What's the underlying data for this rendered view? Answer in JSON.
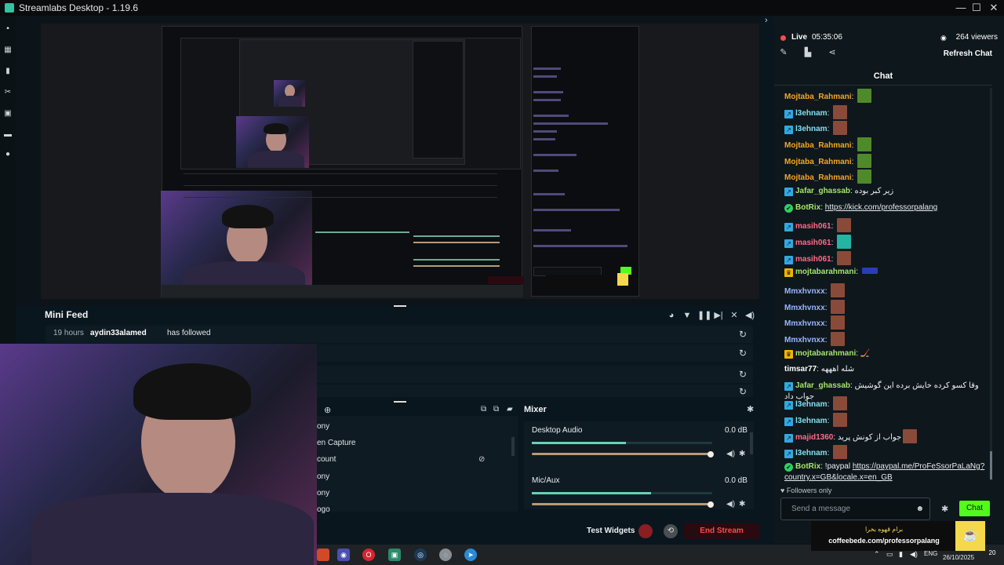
{
  "app": {
    "title": "Streamlabs Desktop - 1.19.6",
    "window_controls": [
      "—",
      "☐",
      "✕"
    ]
  },
  "nav_icons": [
    "studio-icon",
    "themes-icon",
    "layout-icon",
    "tools-icon",
    "store-icon",
    "cast-icon",
    "highlighter-icon"
  ],
  "mini_feed": {
    "title": "Mini Feed",
    "controls": [
      "pie-chart-icon",
      "filter-icon",
      "pause-icon",
      "skip-icon",
      "mute-alerts-icon",
      "volume-icon"
    ],
    "rows": [
      {
        "time": "19 hours",
        "user": "aydin33alamed",
        "action": "has followed",
        "replay": "↻"
      },
      {
        "time": "",
        "user": "",
        "action": "",
        "replay": "↻"
      },
      {
        "time": "",
        "user": "",
        "action": "",
        "replay": "↻"
      },
      {
        "time": "",
        "user": "",
        "action": "",
        "replay": "↻"
      }
    ]
  },
  "sources": {
    "items": [
      "ony",
      "en Capture",
      "count",
      "ony",
      "ony",
      "ogo"
    ]
  },
  "mixer": {
    "title": "Mixer",
    "channels": [
      {
        "name": "Desktop Audio",
        "db": "0.0 dB",
        "meter_level": 0.52,
        "slider_level": 1.0
      },
      {
        "name": "Mic/Aux",
        "db": "0.0 dB",
        "meter_level": 0.66,
        "slider_level": 1.0
      }
    ]
  },
  "footer": {
    "test_widgets": "Test Widgets",
    "end_stream": "End Stream"
  },
  "live": {
    "label": "Live",
    "time": "05:35:06",
    "viewers": "264 viewers",
    "refresh_chat": "Refresh Chat"
  },
  "chat": {
    "title": "Chat",
    "messages": [
      {
        "user": "Mojtaba_Rahmani",
        "color": "#f5a623",
        "badge": "",
        "text": "",
        "emote": "green"
      },
      {
        "user": "l3ehnam",
        "color": "#7ee0f0",
        "badge": "sub",
        "text": "",
        "emote": "face"
      },
      {
        "user": "l3ehnam",
        "color": "#7ee0f0",
        "badge": "sub",
        "text": "",
        "emote": "face"
      },
      {
        "user": "Mojtaba_Rahmani",
        "color": "#f5a623",
        "badge": "",
        "text": "",
        "emote": "green"
      },
      {
        "user": "Mojtaba_Rahmani",
        "color": "#f5a623",
        "badge": "",
        "text": "",
        "emote": "green"
      },
      {
        "user": "Mojtaba_Rahmani",
        "color": "#f5a623",
        "badge": "",
        "text": "",
        "emote": "green"
      },
      {
        "user": "Jafar_ghassab",
        "color": "#a6e36e",
        "badge": "sub",
        "text": "زیر کبر بوده",
        "emote": ""
      },
      {
        "user": "BotRix",
        "color": "#a6e36e",
        "badge": "bot",
        "text": "",
        "link": "https://kick.com/professorpalang",
        "emote": ""
      },
      {
        "user": "masih061",
        "color": "#ff6b8a",
        "badge": "sub",
        "text": "",
        "emote": "face"
      },
      {
        "user": "masih061",
        "color": "#ff6b8a",
        "badge": "sub",
        "text": "",
        "emote": "teal"
      },
      {
        "user": "masih061",
        "color": "#ff6b8a",
        "badge": "sub",
        "text": "",
        "emote": "face"
      },
      {
        "user": "mojtabarahmani",
        "color": "#a6e36e",
        "badge": "crown",
        "text": "",
        "emote": "blue"
      },
      {
        "user": "Mmxhvnxx",
        "color": "#9ab6ff",
        "badge": "",
        "text": "",
        "emote": "face"
      },
      {
        "user": "Mmxhvnxx",
        "color": "#9ab6ff",
        "badge": "",
        "text": "",
        "emote": "face"
      },
      {
        "user": "Mmxhvnxx",
        "color": "#9ab6ff",
        "badge": "",
        "text": "",
        "emote": "face"
      },
      {
        "user": "Mmxhvnxx",
        "color": "#9ab6ff",
        "badge": "",
        "text": "",
        "emote": "face"
      },
      {
        "user": "mojtabarahmani",
        "color": "#a6e36e",
        "badge": "crown",
        "text": "🏒",
        "emote": ""
      },
      {
        "user": "timsar77",
        "color": "#ffffff",
        "badge": "",
        "text": "شله اهههه",
        "emote": ""
      },
      {
        "user": "Jafar_ghassab",
        "color": "#a6e36e",
        "badge": "sub",
        "text": "وقا کسو کرده خایش برده این گوشیش جواب داد",
        "emote": ""
      },
      {
        "user": "l3ehnam",
        "color": "#7ee0f0",
        "badge": "sub",
        "text": "",
        "emote": "face"
      },
      {
        "user": "l3ehnam",
        "color": "#7ee0f0",
        "badge": "sub",
        "text": "",
        "emote": "face"
      },
      {
        "user": "majid1360",
        "color": "#ff6b8a",
        "badge": "sub",
        "text": "جواب از کونش پرید",
        "emote": "face"
      },
      {
        "user": "l3ehnam",
        "color": "#7ee0f0",
        "badge": "sub",
        "text": "",
        "emote": "face"
      },
      {
        "user": "BotRix",
        "color": "#a6e36e",
        "badge": "bot",
        "text": "!paypal",
        "link": "https://paypal.me/ProFeSsorPaLaNg?country.x=GB&locale.x=en_GB",
        "emote": ""
      }
    ],
    "followers_only": "Followers only",
    "input_placeholder": "Send a message",
    "send_label": "Chat"
  },
  "coffee_banner": {
    "fa_text": "برام قهوه بخرا",
    "url": "coffeebede.com/professorpalang"
  },
  "taskbar": {
    "lang": "ENG",
    "date": "26/10/2025",
    "notifications": "20"
  },
  "colors": {
    "accent_green": "#53fc18",
    "live_red": "#ff4a4a",
    "end_stream_red": "#ff4a4a",
    "meter_teal": "#68d0b5"
  }
}
